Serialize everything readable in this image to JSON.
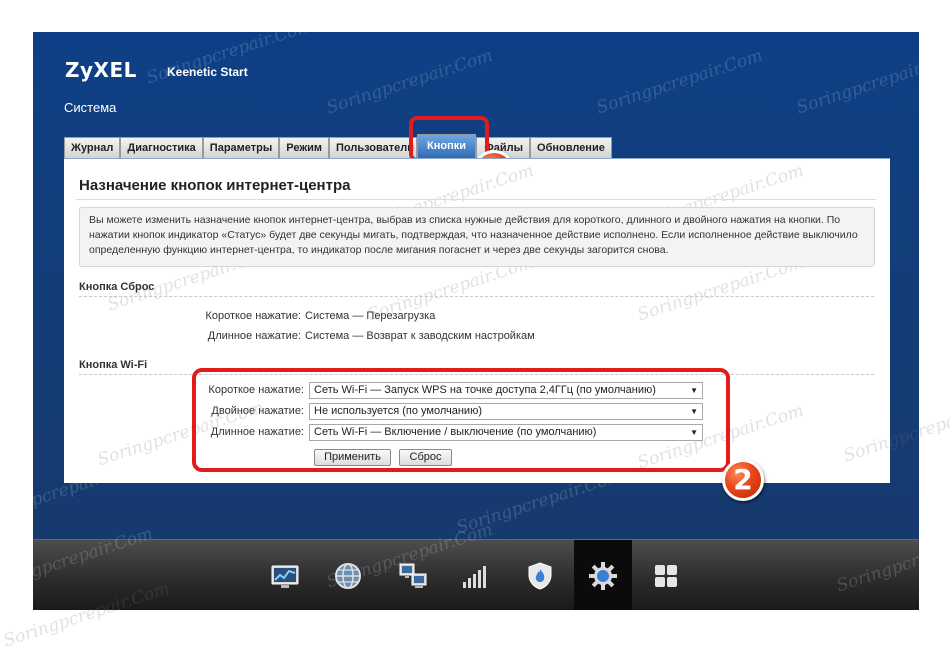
{
  "header": {
    "brand": "ZyXEL",
    "product": "Keenetic Start",
    "section": "Система"
  },
  "tabs": [
    {
      "label": "Журнал"
    },
    {
      "label": "Диагностика"
    },
    {
      "label": "Параметры"
    },
    {
      "label": "Режим"
    },
    {
      "label": "Пользователи"
    },
    {
      "label": "Кнопки",
      "active": true
    },
    {
      "label": "Файлы"
    },
    {
      "label": "Обновление"
    }
  ],
  "panel": {
    "title": "Назначение кнопок интернет-центра",
    "info": "Вы можете изменить назначение кнопок интернет-центра, выбрав из списка нужные действия для короткого, длинного и двойного нажатия на кнопки. По нажатии кнопок индикатор «Статус» будет две секунды мигать, подтверждая, что назначенное действие исполнено. Если исполненное действие выключило определенную функцию интернет-центра, то индикатор после мигания погаснет и через две секунды загорится снова."
  },
  "reset_button": {
    "heading": "Кнопка Сброс",
    "short_label": "Короткое нажатие:",
    "short_value": "Система — Перезагрузка",
    "long_label": "Длинное нажатие:",
    "long_value": "Система — Возврат к заводским настройкам"
  },
  "wifi_button": {
    "heading": "Кнопка Wi-Fi",
    "short_label": "Короткое нажатие:",
    "short_value": "Сеть Wi-Fi — Запуск WPS на точке доступа 2,4ГГц (по умолчанию)",
    "double_label": "Двойное нажатие:",
    "double_value": "Не используется (по умолчанию)",
    "long_label": "Длинное нажатие:",
    "long_value": "Сеть Wi-Fi — Включение / выключение (по умолчанию)",
    "apply_label": "Применить",
    "reset_label": "Сброс"
  },
  "annotations": {
    "badge1": "1",
    "badge2": "2",
    "highlight_color": "#e01c1c"
  },
  "watermark": "Soringpcrepair.Com",
  "dock": [
    {
      "icon": "chart-monitor-icon"
    },
    {
      "icon": "globe-icon"
    },
    {
      "icon": "network-computers-icon"
    },
    {
      "icon": "signal-bars-icon"
    },
    {
      "icon": "shield-flame-icon"
    },
    {
      "icon": "gear-icon",
      "active": true
    },
    {
      "icon": "apps-grid-icon"
    }
  ],
  "colors": {
    "background_blue": "#123e7c",
    "active_tab": "#2f6cb8"
  }
}
